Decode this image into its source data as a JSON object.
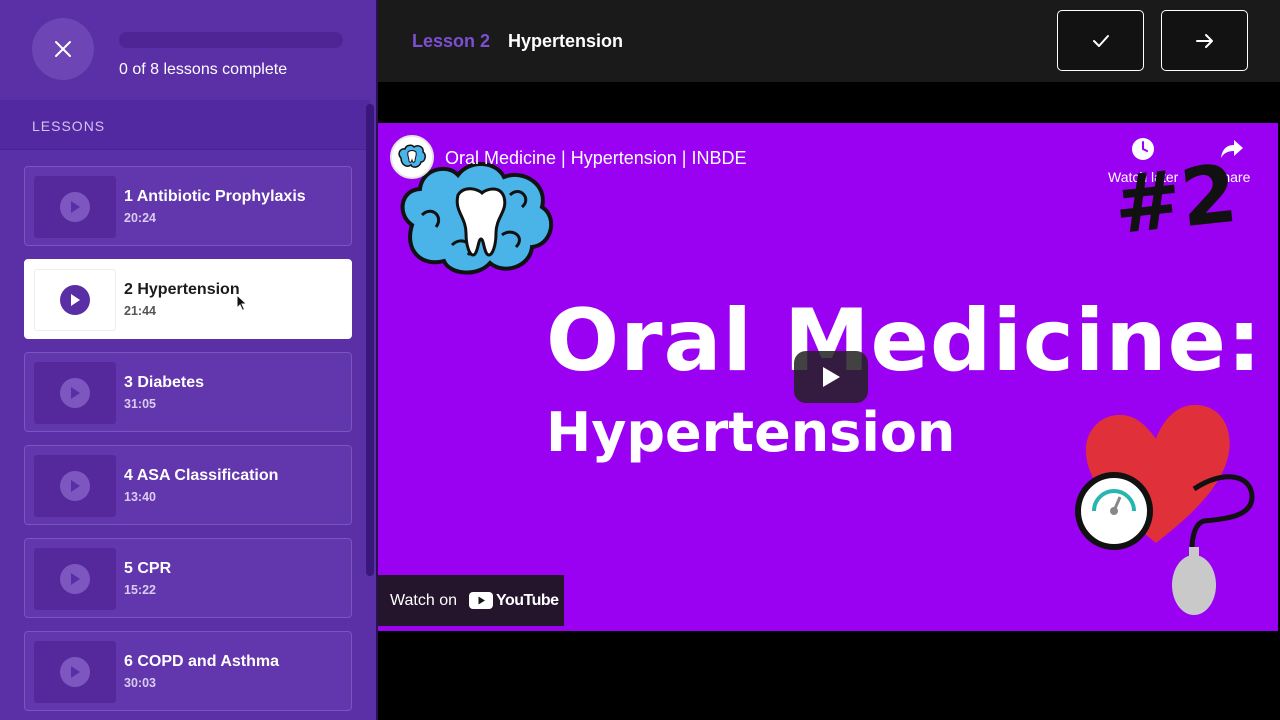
{
  "sidebar": {
    "progress_text": "0 of 8 lessons complete",
    "progress_fraction": 0,
    "lessons_heading": "LESSONS",
    "lessons": [
      {
        "title": "1 Antibiotic Prophylaxis",
        "duration": "20:24",
        "active": false
      },
      {
        "title": "2 Hypertension",
        "duration": "21:44",
        "active": true
      },
      {
        "title": "3 Diabetes",
        "duration": "31:05",
        "active": false
      },
      {
        "title": "4 ASA Classification",
        "duration": "13:40",
        "active": false
      },
      {
        "title": "5 CPR",
        "duration": "15:22",
        "active": false
      },
      {
        "title": "6 COPD and Asthma",
        "duration": "30:03",
        "active": false
      }
    ]
  },
  "header": {
    "lesson_number": "Lesson 2",
    "lesson_title": "Hypertension"
  },
  "video": {
    "title": "Oral Medicine | Hypertension | INBDE",
    "watch_later_label": "Watch later",
    "share_label": "Share",
    "thumbnail_heading": "Oral Medicine:",
    "thumbnail_subheading": "Hypertension",
    "thumbnail_badge": "#2",
    "watch_on_label": "Watch on",
    "youtube_word": "YouTube"
  },
  "colors": {
    "sidebar_bg": "#5b2fa6",
    "accent_purple": "#7d4fd1",
    "video_bg": "#9a00f2"
  }
}
